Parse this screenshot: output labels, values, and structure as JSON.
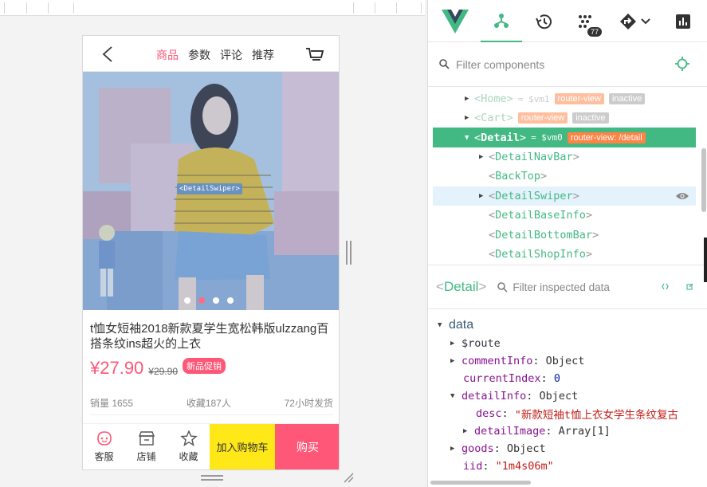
{
  "device": {
    "navbar": {
      "tabs": [
        "商品",
        "参数",
        "评论",
        "推荐"
      ],
      "active_tab": 0
    },
    "swiper": {
      "component_tag": "<DetailSwiper>",
      "active_dot": 1
    },
    "product": {
      "title": "t恤女短袖2018新款夏学生宽松韩版ulzzang百搭条纹ins超火的上衣",
      "price": "¥27.90",
      "old_price": "¥29.90",
      "promo": "新品促销",
      "sales": "销量 1655",
      "favorites": "收藏187人",
      "shipping": "72小时发货"
    },
    "bottombar": {
      "service_label": "客服",
      "shop_label": "店铺",
      "favorite_label": "收藏",
      "add_cart_label": "加入购物车",
      "buy_label": "购买"
    }
  },
  "devtools": {
    "badge_count": "77",
    "filter_placeholder": "Filter components",
    "tree": {
      "home": {
        "name": "Home",
        "vm": "= $vm1",
        "pill": "router-view",
        "status": "inactive"
      },
      "cart": {
        "name": "Cart",
        "pill": "router-view",
        "status": "inactive"
      },
      "detail": {
        "name": "Detail",
        "vm": "= $vm0",
        "pill": "router-view: /detail"
      },
      "children": [
        "DetailNavBar",
        "BackTop",
        "DetailSwiper",
        "DetailBaseInfo",
        "DetailBottomBar",
        "DetailShopInfo"
      ]
    },
    "inspector": {
      "component": "Detail",
      "filter_placeholder": "Filter inspected data"
    },
    "data": {
      "section": "data",
      "route_key": "$route",
      "commentInfo_key": "commentInfo",
      "commentInfo_val": "Object",
      "currentIndex_key": "currentIndex",
      "currentIndex_val": "0",
      "detailInfo_key": "detailInfo",
      "detailInfo_val": "Object",
      "desc_key": "desc",
      "desc_val": "\"新款短袖t恤上衣女学生条纹复古",
      "detailImage_key": "detailImage",
      "detailImage_val": "Array[1]",
      "goods_key": "goods",
      "goods_val": "Object",
      "iid_key": "iid",
      "iid_val": "\"1m4s06m\""
    }
  },
  "colors": {
    "vue_green": "#42b983",
    "brand_pink": "#ff5777",
    "cart_yellow": "#ffe817",
    "router_orange": "#ff8344"
  }
}
